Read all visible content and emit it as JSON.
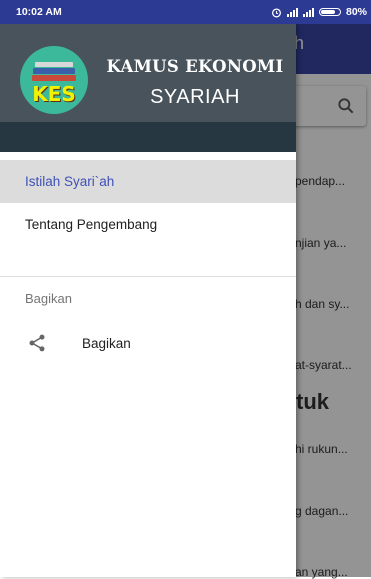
{
  "status_bar": {
    "time": "10:02 AM",
    "battery": "80%"
  },
  "app": {
    "title_fragment": "h",
    "background_rows": [
      "pendap...",
      "njian ya...",
      "h dan sy...",
      "at-syarat...",
      "hi rukun...",
      "g dagan...",
      "an yang..."
    ],
    "heading_fragment": "tuk"
  },
  "drawer": {
    "logo_text": "KES",
    "app_name_line1": "KAMUS EKONOMI",
    "app_name_line2": "SYARIAH",
    "items": [
      {
        "label": "Istilah Syari`ah",
        "active": true
      },
      {
        "label": "Tentang Pengembang",
        "active": false
      }
    ],
    "section_label": "Bagikan",
    "share_label": "Bagikan"
  },
  "colors": {
    "status_bar": "#2c3a94",
    "app_bar": "#3946a6",
    "drawer_header": "#48535c",
    "active_text": "#3f51b5",
    "logo_circle": "#3cb89a"
  }
}
